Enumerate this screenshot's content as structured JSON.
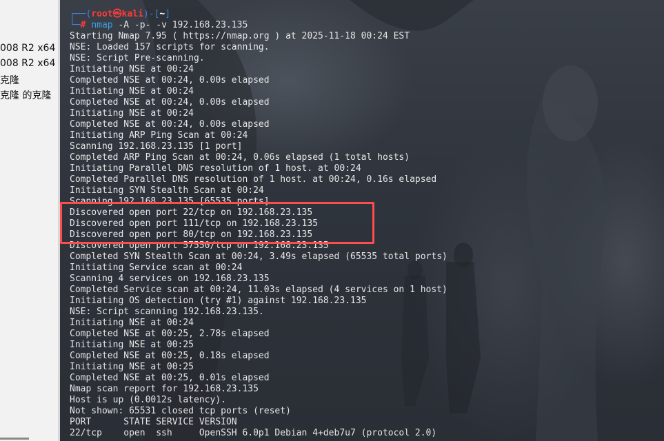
{
  "left_panel": {
    "items": [
      "008 R2 x64",
      "008 R2 x64",
      "克隆",
      "克隆 的克隆"
    ]
  },
  "terminal": {
    "prompt": {
      "open": "┌──(",
      "user": "root㉿kali",
      "mid": ")-[",
      "dir": "~",
      "close": "]",
      "line2": "└─",
      "hash": "# ",
      "cmd": "nmap",
      "args": " -A -p- -v 192.168.23.135"
    },
    "lines": [
      "Starting Nmap 7.95 ( https://nmap.org ) at 2025-11-18 00:24 EST",
      "NSE: Loaded 157 scripts for scanning.",
      "NSE: Script Pre-scanning.",
      "Initiating NSE at 00:24",
      "Completed NSE at 00:24, 0.00s elapsed",
      "Initiating NSE at 00:24",
      "Completed NSE at 00:24, 0.00s elapsed",
      "Initiating NSE at 00:24",
      "Completed NSE at 00:24, 0.00s elapsed",
      "Initiating ARP Ping Scan at 00:24",
      "Scanning 192.168.23.135 [1 port]",
      "Completed ARP Ping Scan at 00:24, 0.06s elapsed (1 total hosts)",
      "Initiating Parallel DNS resolution of 1 host. at 00:24",
      "Completed Parallel DNS resolution of 1 host. at 00:24, 0.16s elapsed",
      "Initiating SYN Stealth Scan at 00:24",
      "Scanning 192.168.23.135 [65535 ports]",
      "Discovered open port 22/tcp on 192.168.23.135",
      "Discovered open port 111/tcp on 192.168.23.135",
      "Discovered open port 80/tcp on 192.168.23.135",
      "Discovered open port 57550/tcp on 192.168.23.135",
      "Completed SYN Stealth Scan at 00:24, 3.49s elapsed (65535 total ports)",
      "Initiating Service scan at 00:24",
      "Scanning 4 services on 192.168.23.135",
      "Completed Service scan at 00:24, 11.03s elapsed (4 services on 1 host)",
      "Initiating OS detection (try #1) against 192.168.23.135",
      "NSE: Script scanning 192.168.23.135.",
      "Initiating NSE at 00:24",
      "Completed NSE at 00:25, 2.78s elapsed",
      "Initiating NSE at 00:25",
      "Completed NSE at 00:25, 0.18s elapsed",
      "Initiating NSE at 00:25",
      "Completed NSE at 00:25, 0.01s elapsed",
      "Nmap scan report for 192.168.23.135",
      "Host is up (0.0012s latency).",
      "Not shown: 65531 closed tcp ports (reset)",
      "PORT      STATE SERVICE VERSION",
      "22/tcp    open  ssh     OpenSSH 6.0p1 Debian 4+deb7u7 (protocol 2.0)"
    ]
  },
  "colors": {
    "highlight": "#ff4d4d",
    "prompt_user": "#ff3b3b",
    "prompt_bracket": "#3f7fe0",
    "command": "#3da1e8",
    "terminal_text": "#e6e6e6"
  }
}
